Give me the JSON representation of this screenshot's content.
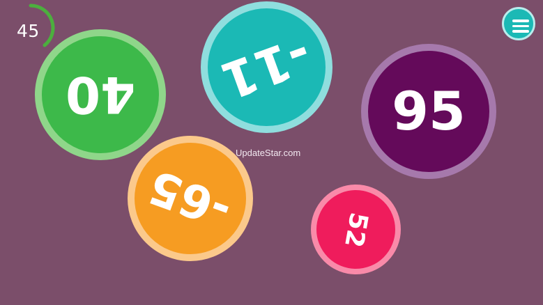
{
  "colors": {
    "background": "#7b4e6a",
    "timer_arc": "#4caf3e",
    "menu_fill": "#1bb9b5",
    "menu_ring": "#b9ecec"
  },
  "timer": {
    "value": "45"
  },
  "menu": {
    "icon": "hamburger-menu-icon"
  },
  "watermark": "UpdateStar.com",
  "bubbles": [
    {
      "label": "40",
      "rotation_deg": 180,
      "fill": "#3db94a",
      "ring": "#8fd68a"
    },
    {
      "label": "-11",
      "rotation_deg": 160,
      "fill": "#1bb9b5",
      "ring": "#8fdede"
    },
    {
      "label": "95",
      "rotation_deg": 0,
      "fill": "#640a5a",
      "ring": "#a679ac"
    },
    {
      "label": "-65",
      "rotation_deg": 200,
      "fill": "#f69c22",
      "ring": "#fbc98b"
    },
    {
      "label": "52",
      "rotation_deg": 100,
      "fill": "#ef1c5c",
      "ring": "#f98aa9"
    }
  ]
}
